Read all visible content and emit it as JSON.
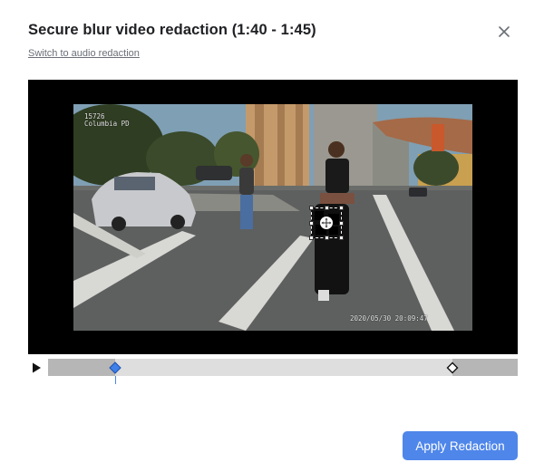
{
  "dialog": {
    "title": "Secure blur video redaction (1:40 - 1:45)",
    "switch_link": "Switch to audio redaction",
    "apply_button": "Apply Redaction"
  },
  "video": {
    "overlay_top_left": [
      "15726",
      "Columbia PD"
    ],
    "overlay_bottom_right": "2020/05/30  20:09:47"
  },
  "timeline": {
    "start_marker_fraction": 0.143,
    "end_marker_fraction": 0.861,
    "playhead_fraction": 0.143
  },
  "colors": {
    "accent": "#4f86ea",
    "track_bg": "#b6b6b6",
    "track_range": "#dedede"
  },
  "icons": {
    "close": "close-icon",
    "play": "play-icon",
    "move": "move-icon",
    "start_marker": "diamond-marker-icon",
    "end_marker": "diamond-marker-icon"
  }
}
